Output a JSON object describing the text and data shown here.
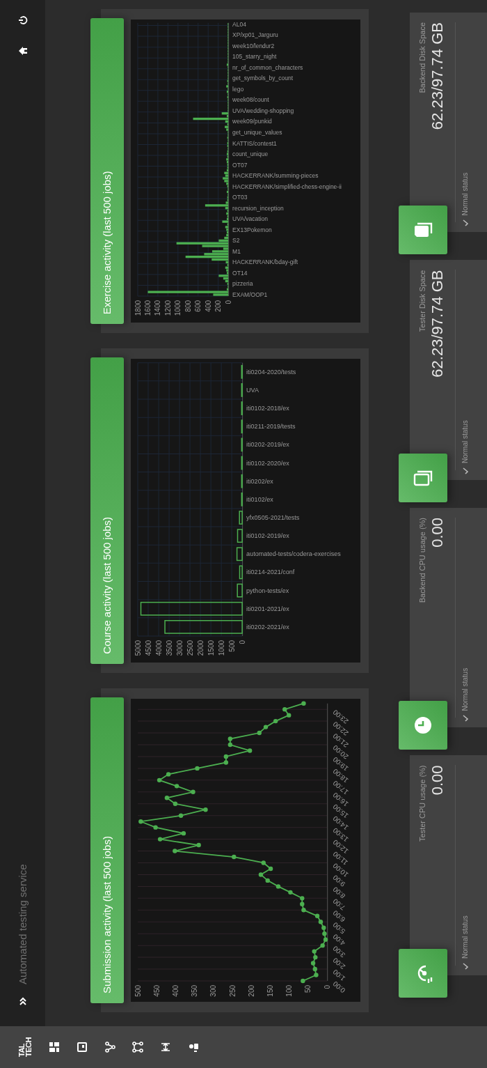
{
  "sidebar": {
    "logo": [
      "TAL",
      "TECH"
    ]
  },
  "top_bar": {
    "title": "Automated testing service"
  },
  "charts": [
    {
      "title": "Submission activity (last 500 jobs)",
      "chart_data": {
        "type": "line",
        "orientation": "horizontal",
        "grid": true,
        "x": [
          0,
          0.5,
          1,
          1.5,
          2,
          2.5,
          3,
          3.5,
          4,
          4.5,
          5,
          5.5,
          6,
          6.5,
          7,
          7.5,
          8,
          8.5,
          9,
          9.5,
          10,
          10.5,
          11,
          11.5,
          12,
          12.5,
          13,
          13.5,
          14,
          14.5,
          15,
          15.5,
          16,
          16.5,
          17,
          17.5,
          18,
          18.5,
          19,
          19.5,
          20,
          20.5,
          21,
          21.5,
          22,
          22.5,
          23,
          23.5
        ],
        "series": [
          {
            "color": "#4caf50",
            "marker": "o",
            "values": [
              64,
              29,
              32,
              37,
              31,
              34,
              12,
              4,
              7,
              9,
              17,
              26,
              62,
              66,
              66,
              97,
              129,
              157,
              175,
              149,
              168,
              246,
              402,
              339,
              441,
              379,
              453,
              492,
              386,
              321,
              401,
              423,
              354,
              397,
              443,
              419,
              343,
              267,
              267,
              204,
              256,
              256,
              179,
              162,
              136,
              101,
              112,
              62
            ]
          }
        ],
        "xlim": [
          500,
          0
        ],
        "xticks": [
          500,
          450,
          400,
          350,
          300,
          250,
          200,
          150,
          100,
          50,
          0
        ],
        "ylim": [
          0,
          23.5
        ],
        "yticks": [
          {
            "value": 0,
            "label": "0:00"
          },
          {
            "value": 1,
            "label": "1:00"
          },
          {
            "value": 2,
            "label": "2:00"
          },
          {
            "value": 3,
            "label": "3:00"
          },
          {
            "value": 4,
            "label": "4:00"
          },
          {
            "value": 5,
            "label": "5:00"
          },
          {
            "value": 6,
            "label": "6:00"
          },
          {
            "value": 7,
            "label": "7:00"
          },
          {
            "value": 8,
            "label": "8:00"
          },
          {
            "value": 9,
            "label": "9:00"
          },
          {
            "value": 10,
            "label": "10:00"
          },
          {
            "value": 11,
            "label": "11:00"
          },
          {
            "value": 12,
            "label": "12:00"
          },
          {
            "value": 13,
            "label": "13:00"
          },
          {
            "value": 14,
            "label": "14:00"
          },
          {
            "value": 15,
            "label": "15:00"
          },
          {
            "value": 16,
            "label": "16:00"
          },
          {
            "value": 17,
            "label": "17:00"
          },
          {
            "value": 18,
            "label": "18:00"
          },
          {
            "value": 19,
            "label": "19:00"
          },
          {
            "value": 20,
            "label": "20:00"
          },
          {
            "value": 21,
            "label": "21:00"
          },
          {
            "value": 22,
            "label": "22:00"
          },
          {
            "value": 23,
            "label": "23:00"
          }
        ]
      }
    },
    {
      "title": "Course activity (last 500 jobs)",
      "chart_data": {
        "type": "bar",
        "orientation": "horizontal",
        "grid": true,
        "categories": [
          "iti0204-2020/tests",
          "UVA",
          "iti0102-2018/ex",
          "iti0211-2019/tests",
          "iti0202-2019/ex",
          "iti0102-2020/ex",
          "iti0202/ex",
          "iti0102/ex",
          "yfx0505-2021/tests",
          "iti0102-2019/ex",
          "automated-tests/codera-exercises",
          "iti0214-2021/conf",
          "python-tests/ex",
          "iti0201-2021/ex",
          "iti0202-2021/ex"
        ],
        "series": [
          {
            "color": "#4caf50",
            "values": [
              0,
              10,
              0,
              10,
              0,
              0,
              10,
              20,
              130,
              220,
              250,
              120,
              230,
              4850,
              3700
            ]
          }
        ],
        "xlim": [
          5000,
          0
        ],
        "xticks": [
          5000,
          4500,
          4000,
          3500,
          3000,
          2500,
          2000,
          1500,
          1000,
          500,
          0
        ]
      }
    },
    {
      "title": "Exercise activity (last 500 jobs)",
      "chart_data": {
        "type": "bar",
        "orientation": "horizontal",
        "grid": true,
        "categories": [
          "AL04",
          null,
          null,
          null,
          "XP/xp01_Jarguru",
          null,
          null,
          null,
          "week10/lendur2",
          null,
          null,
          null,
          "105_starry_night",
          null,
          null,
          null,
          "nr_of_common_characters",
          null,
          null,
          null,
          "get_symbols_by_count",
          null,
          null,
          null,
          "lego",
          null,
          null,
          null,
          "week08/count",
          null,
          null,
          null,
          "UVA/wedding-shopping",
          null,
          null,
          null,
          "week09/punkid",
          null,
          null,
          null,
          "get_unique_values",
          null,
          null,
          null,
          "KATTIS/contest1",
          null,
          null,
          null,
          "count_unique",
          null,
          null,
          null,
          "OT07",
          null,
          null,
          null,
          "HACKERRANK/summing-pieces",
          null,
          null,
          null,
          "HACKERRANK/simplified-chess-engine-ii",
          null,
          null,
          null,
          "OT03",
          null,
          null,
          null,
          "recursion_inception",
          null,
          null,
          null,
          "UVA/vacation",
          null,
          null,
          null,
          "EX13Pokemon",
          null,
          null,
          null,
          "S2",
          null,
          null,
          null,
          "M1",
          null,
          null,
          null,
          "HACKERRANK/bday-gift",
          null,
          null,
          null,
          "OT14",
          null,
          null,
          null,
          "pizzeria",
          null,
          null,
          null,
          "EXAM/OOP1"
        ],
        "series": [
          {
            "color": "#4caf50",
            "values": [
              0,
              0,
              0,
              0,
              0,
              0,
              0,
              0,
              0,
              0,
              10,
              0,
              0,
              0,
              0,
              30,
              0,
              10,
              0,
              0,
              10,
              20,
              0,
              40,
              0,
              30,
              0,
              20,
              0,
              0,
              10,
              0,
              10,
              130,
              30,
              700,
              60,
              20,
              70,
              40,
              10,
              10,
              20,
              10,
              20,
              20,
              10,
              20,
              30,
              20,
              40,
              30,
              20,
              20,
              30,
              80,
              60,
              110,
              80,
              40,
              20,
              10,
              30,
              10,
              20,
              20,
              50,
              460,
              60,
              20,
              40,
              20,
              30,
              120,
              20,
              60,
              40,
              30,
              40,
              80,
              190,
              1030,
              520,
              100,
              320,
              480,
              850,
              330,
              50,
              20,
              60,
              40,
              30,
              190,
              100,
              60,
              20,
              10,
              30,
              1600,
              300
            ]
          }
        ],
        "xlim": [
          1800,
          0
        ],
        "xticks": [
          1800,
          1600,
          1400,
          1200,
          1000,
          800,
          600,
          400,
          200,
          0
        ]
      }
    }
  ],
  "stats": [
    {
      "title": "Tester CPU usage (%)",
      "value": "0.00",
      "status": "Normal status"
    },
    {
      "title": "Backend CPU usage (%)",
      "value": "0.00",
      "status": "Normal status"
    },
    {
      "title": "Tester Disk Space",
      "value": "62.23/97.74 GB",
      "status": "Normal status"
    },
    {
      "title": "Backend Disk Space",
      "value": "62.23/97.74 GB",
      "status": "Normal status"
    }
  ]
}
